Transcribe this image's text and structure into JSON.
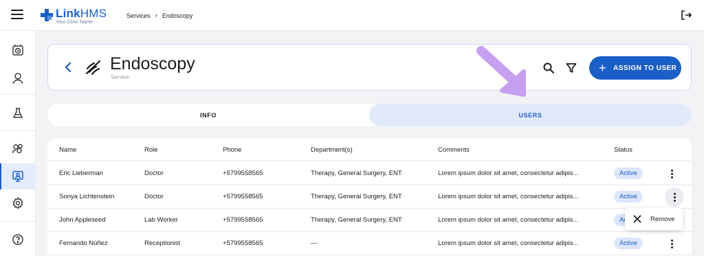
{
  "app": {
    "logo_name_bold": "Link",
    "logo_name_light": "HMS",
    "logo_tagline": "Your Clinic Name",
    "brand_color": "#1a5ec8"
  },
  "breadcrumb": {
    "items": [
      "Services",
      "Endoscopy"
    ],
    "separator": "›"
  },
  "sidebar": {
    "items": [
      {
        "icon": "calendar-clock-icon",
        "active": false
      },
      {
        "icon": "user-icon",
        "active": false
      },
      {
        "icon": "flask-icon",
        "active": false
      },
      {
        "icon": "users-group-icon",
        "active": false
      },
      {
        "icon": "monitor-user-icon",
        "active": true
      },
      {
        "icon": "gear-icon",
        "active": false
      },
      {
        "icon": "help-icon",
        "active": false
      }
    ]
  },
  "header": {
    "title": "Endoscopy",
    "subtitle": "Service",
    "assign_label": "ASSIGN TO USER"
  },
  "tabs": [
    {
      "label": "INFO",
      "active": false
    },
    {
      "label": "USERS",
      "active": true
    }
  ],
  "table": {
    "columns": [
      "Name",
      "Role",
      "Phone",
      "Department(s)",
      "Comments",
      "Status"
    ],
    "rows": [
      {
        "name": "Eric Lieberman",
        "role": "Doctor",
        "phone": "+5799558565",
        "dept": "Therapy, General Surgery, ENT",
        "comment": "Lorem ipsum dolor sit amet, consectetur adipis...",
        "status": "Active"
      },
      {
        "name": "Sonya Lichtenstein",
        "role": "Doctor",
        "phone": "+5799558565",
        "dept": "Therapy, General Surgery, ENT",
        "comment": "Lorem ipsum dolor sit amet, consectetur adipis...",
        "status": "Active"
      },
      {
        "name": "John Appleseed",
        "role": "Lab Worker",
        "phone": "+5799558565",
        "dept": "Therapy, General Surgery, ENT",
        "comment": "Lorem ipsum dolor sit amet, consectetur adipis...",
        "status": "Active"
      },
      {
        "name": "Fernando Núñez",
        "role": "Receptionist",
        "phone": "+5799558565",
        "dept": "—",
        "comment": "Lorem ipsum dolor sit amet, consectetur adipis...",
        "status": "Active"
      }
    ]
  },
  "row_menu": {
    "remove_label": "Remove"
  }
}
